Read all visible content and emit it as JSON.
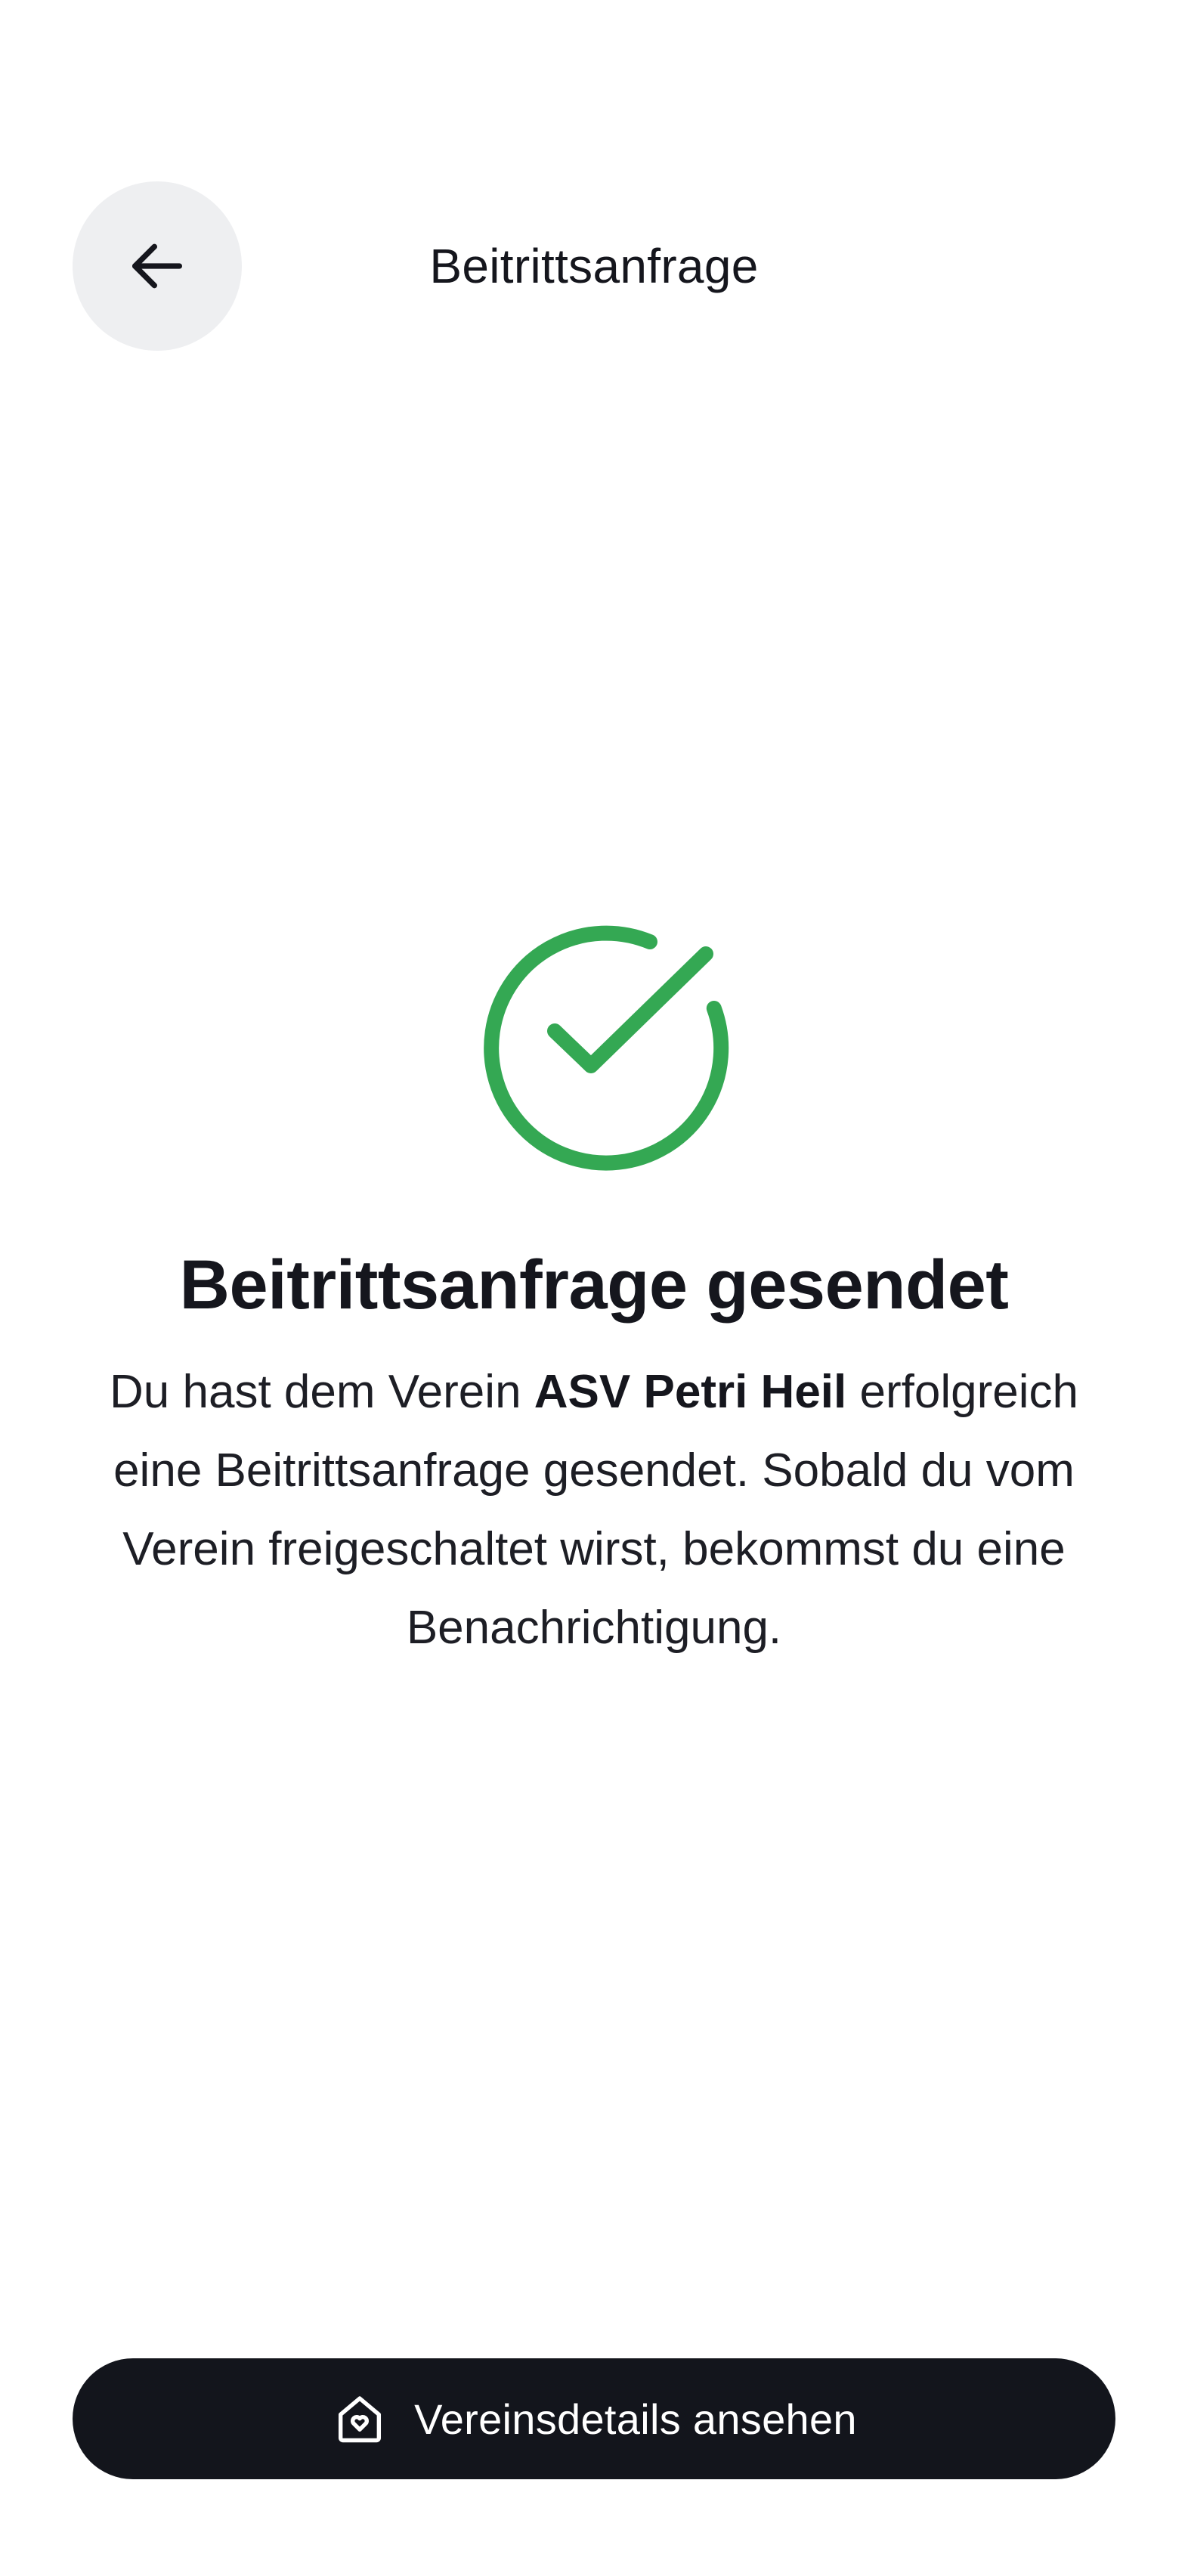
{
  "header": {
    "back_icon": "arrow-left-icon",
    "title": "Beitrittsanfrage"
  },
  "confirmation": {
    "icon": "check-circle-icon",
    "icon_color": "#34a853",
    "title": "Beitrittsanfrage gesendet",
    "message_prefix": "Du hast dem Verein ",
    "club_name": "ASV Petri Heil",
    "message_suffix": " erfolgreich eine Beitrittsanfrage gesendet. Sobald du vom Verein freigeschaltet wirst, bekommst du eine Benachrichtigung."
  },
  "actions": {
    "club_details_icon": "house-heart-icon",
    "club_details_label": "Vereinsdetails ansehen",
    "button_color": "#13151c"
  }
}
